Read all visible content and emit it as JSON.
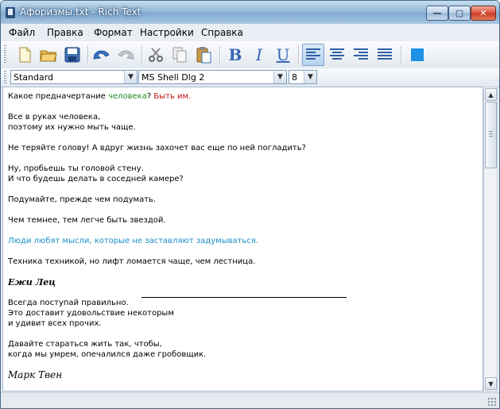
{
  "window": {
    "title": "Афоризмы.txt - Rich Text",
    "min_label": "—",
    "max_label": "▢",
    "close_label": "✕"
  },
  "menu": [
    "Файл",
    "Правка",
    "Формат",
    "Настройки",
    "Справка"
  ],
  "toolbar": {
    "buttons": [
      "new-file-icon",
      "open-folder-icon",
      "save-icon",
      "undo-icon",
      "redo-icon",
      "cut-icon",
      "copy-icon",
      "paste-icon",
      "bold-icon",
      "italic-icon",
      "underline-icon",
      "align-left-icon",
      "align-center-icon",
      "align-right-icon",
      "justify-icon",
      "color-icon"
    ],
    "bold_label": "B",
    "italic_label": "I",
    "underline_label": "U",
    "accent": "#1e90e6"
  },
  "format": {
    "style": "Standard",
    "font": "MS Shell Dlg 2",
    "size": "8"
  },
  "document": {
    "l1a": "Какое предначертание ",
    "l1b": "человека",
    "l1c": "? ",
    "l1d": "Быть им.",
    "l2": "Все в руках человека,",
    "l3": "поэтому их нужно мыть чаще.",
    "l4": "Не теряйте голову! А вдруг жизнь захочет вас еще по ней погладить?",
    "l5": "Ну, пробьешь ты головой стену.",
    "l6": "И что будешь делать в соседней камере?",
    "l7": "Подумайте, прежде чем подумать.",
    "l8": "Чем темнее, тем легче быть звездой.",
    "l9": "Люди любят мысли, которые не заставляют задумываться.",
    "l10": "Техника техникой, но лифт ломается чаще, чем лестница.",
    "sig1": "Ежи Лец",
    "l11": "Всегда поступай правильно.",
    "l12": "Это доставит удовольствие некоторым",
    "l13": "и удивит всех прочих.",
    "l14": "Давайте стараться жить так, чтобы,",
    "l15": "когда мы умрем, опечалился даже гробовщик.",
    "sig2": "Марк Твен"
  }
}
